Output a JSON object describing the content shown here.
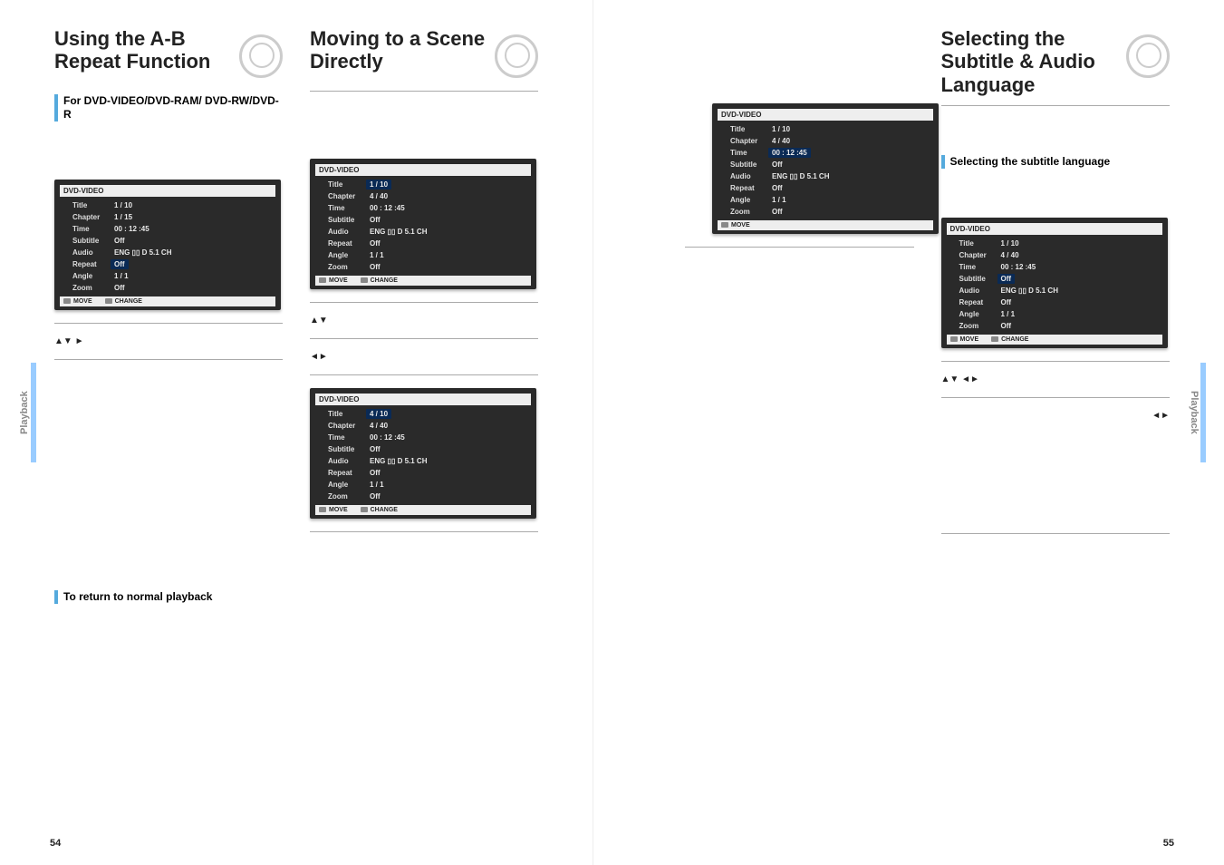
{
  "side_tab": "Playback",
  "page_numbers": {
    "left": "54",
    "right": "55"
  },
  "left_page": {
    "col1": {
      "heading": "Using the A-B Repeat Function",
      "sub_heading": "For DVD-VIDEO/DVD-RAM/ DVD-RW/DVD-R",
      "step2_arrows": "▲▼                                    ►",
      "return_heading": "To return to normal playback"
    },
    "col2": {
      "heading": "Moving to a Scene Directly",
      "step2_arrows": "▲▼",
      "step3_arrows": "◄►"
    }
  },
  "right_page": {
    "col2": {
      "heading": "Selecting the Subtitle & Audio Language",
      "sub_heading": "Selecting the subtitle language",
      "step2_arrows": "▲▼                                   ◄►",
      "step3_arrows": "◄►"
    }
  },
  "osd_common_labels": {
    "header": "DVD-VIDEO",
    "title": "Title",
    "chapter": "Chapter",
    "time": "Time",
    "subtitle": "Subtitle",
    "audio": "Audio",
    "repeat": "Repeat",
    "angle": "Angle",
    "zoom": "Zoom",
    "move": "MOVE",
    "change": "CHANGE"
  },
  "osd_title_repeat": {
    "title": "1 / 10",
    "chapter": "1 / 15",
    "time": "00 : 12 :45",
    "subtitle": "Off",
    "audio": "ENG ▯▯ D 5.1 CH",
    "repeat": "Off",
    "angle": "1 / 1",
    "zoom": "Off"
  },
  "osd_move_title": {
    "title": "1 / 10",
    "chapter": "4 / 40",
    "time": "00 : 12 :45",
    "subtitle": "Off",
    "audio": "ENG ▯▯ D 5.1 CH",
    "repeat": "Off",
    "angle": "1 / 1",
    "zoom": "Off"
  },
  "osd_move_title4": {
    "title": "4 / 10",
    "chapter": "4 / 40",
    "time": "00 : 12 :45",
    "subtitle": "Off",
    "audio": "ENG ▯▯ D 5.1 CH",
    "repeat": "Off",
    "angle": "1 / 1",
    "zoom": "Off"
  },
  "osd_move_time": {
    "title": "1 / 10",
    "chapter": "4 / 40",
    "time": "00 : 12 :45",
    "subtitle": "Off",
    "audio": "ENG ▯▯ D 5.1 CH",
    "repeat": "Off",
    "angle": "1 / 1",
    "zoom": "Off"
  },
  "osd_subtitle": {
    "title": "1 / 10",
    "chapter": "4 / 40",
    "time": "00 : 12 :45",
    "subtitle": "Off",
    "audio": "ENG ▯▯ D 5.1 CH",
    "repeat": "Off",
    "angle": "1 / 1",
    "zoom": "Off"
  }
}
